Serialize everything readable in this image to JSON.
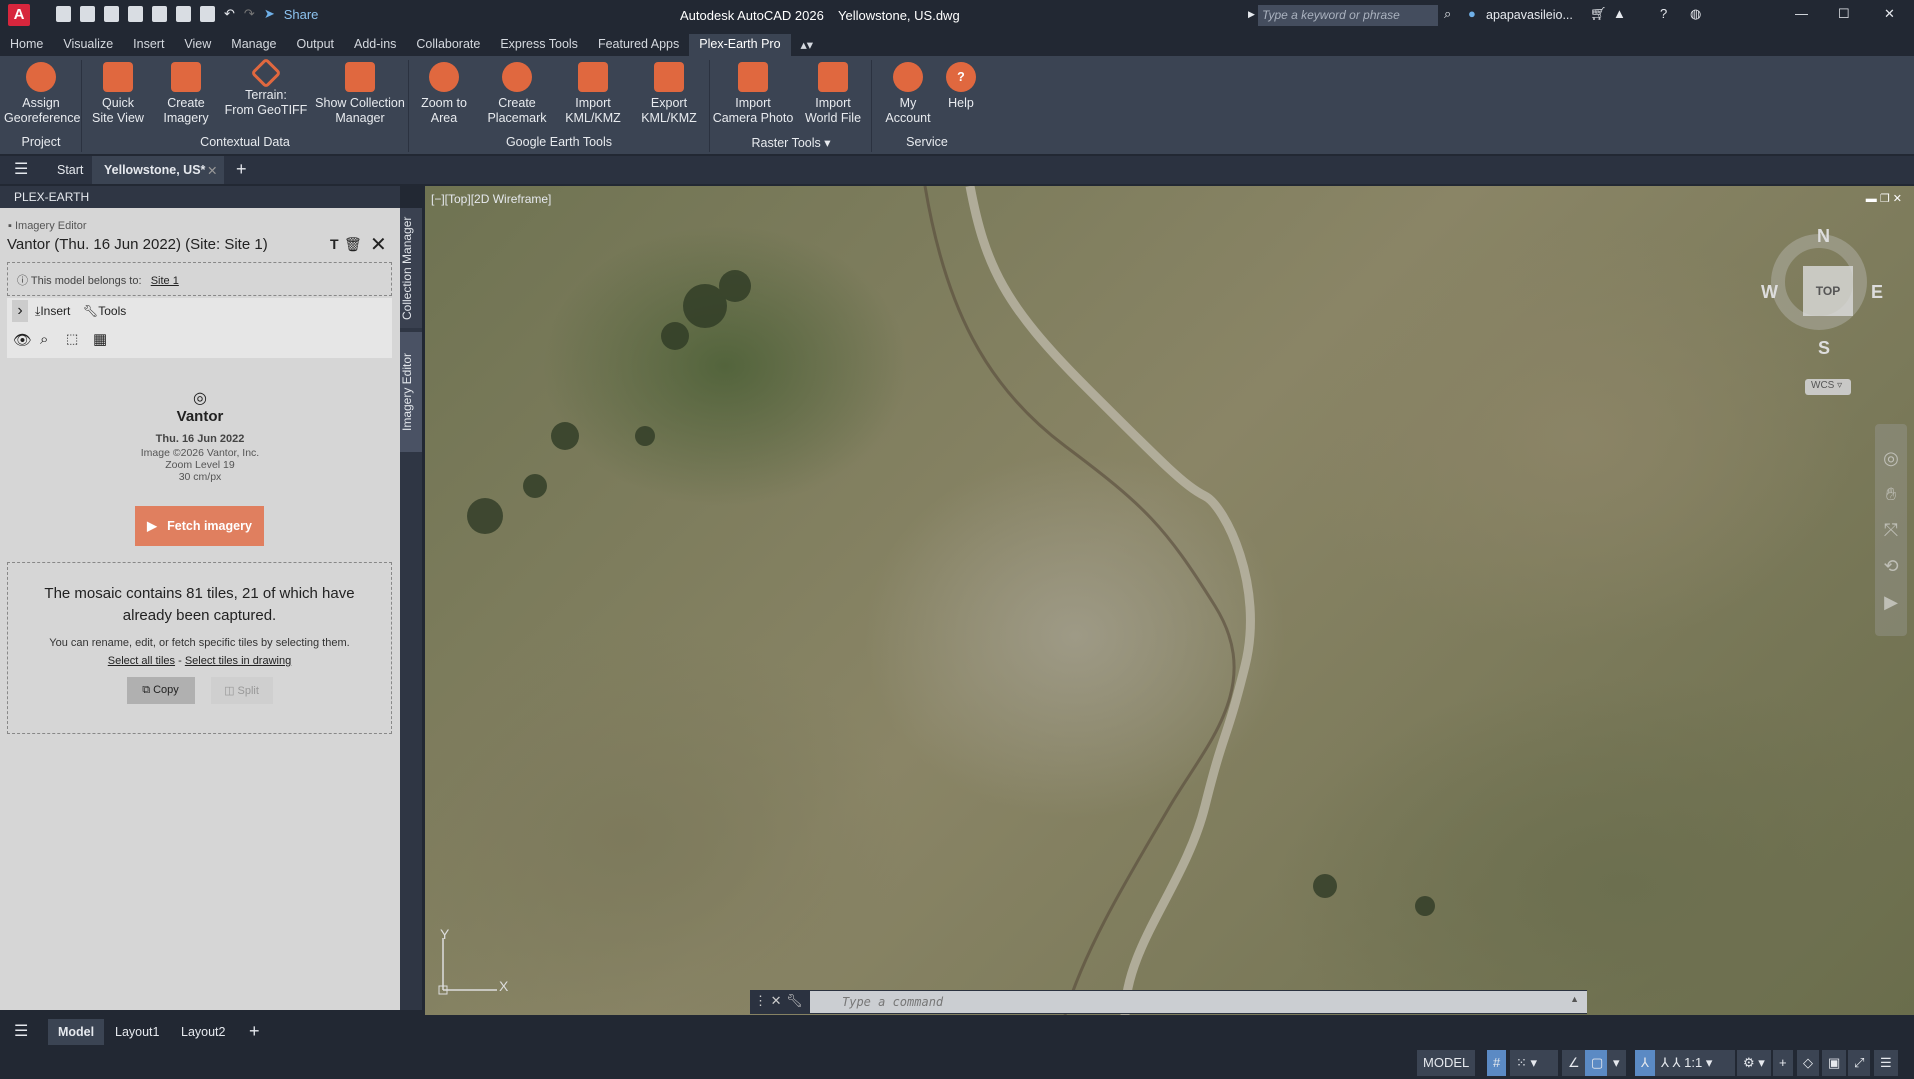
{
  "titlebar": {
    "app_title": "Autodesk AutoCAD 2026    Yellowstone, US.dwg",
    "share": "Share",
    "search_placeholder": "Type a keyword or phrase",
    "user": "apapavasileio...",
    "logo": "A"
  },
  "menu": [
    "Home",
    "Visualize",
    "Insert",
    "View",
    "Manage",
    "Output",
    "Add-ins",
    "Collaborate",
    "Express Tools",
    "Featured Apps",
    "Plex-Earth Pro"
  ],
  "ribbon": {
    "buttons": [
      {
        "l1": "Assign",
        "l2": "Georeference",
        "icon": "georeference-icon"
      },
      {
        "l1": "Quick",
        "l2": "Site View",
        "icon": "quick-site-view-icon"
      },
      {
        "l1": "Create",
        "l2": "Imagery",
        "icon": "create-imagery-icon"
      },
      {
        "l1": "Terrain:",
        "l2": "From GeoTIFF",
        "icon": "terrain-icon"
      },
      {
        "l1": "Show Collection",
        "l2": "Manager",
        "icon": "collection-manager-icon"
      },
      {
        "l1": "Zoom to",
        "l2": "Area",
        "icon": "zoom-to-area-icon"
      },
      {
        "l1": "Create",
        "l2": "Placemark",
        "icon": "placemark-icon"
      },
      {
        "l1": "Import",
        "l2": "KML/KMZ",
        "icon": "import-kml-icon"
      },
      {
        "l1": "Export",
        "l2": "KML/KMZ",
        "icon": "export-kml-icon"
      },
      {
        "l1": "Import",
        "l2": "Camera Photo",
        "icon": "camera-photo-icon"
      },
      {
        "l1": "Import",
        "l2": "World File",
        "icon": "world-file-icon"
      },
      {
        "l1": "My",
        "l2": "Account",
        "icon": "account-icon"
      },
      {
        "l1": "Help",
        "l2": "",
        "icon": "help-icon"
      }
    ],
    "groups": [
      "Project",
      "Contextual Data",
      "Google Earth Tools",
      "Raster Tools ▾",
      "Service"
    ]
  },
  "filetabs": {
    "start": "Start",
    "active": "Yellowstone, US*"
  },
  "panel": {
    "title": "PLEX-EARTH",
    "section": "Imagery Editor",
    "heading": "Vantor (Thu. 16 Jun 2022) (Site: Site 1)",
    "belongs_label": "This model belongs to:",
    "belongs_site": "Site 1",
    "insert": "Insert",
    "tools": "Tools",
    "provider": "Vantor",
    "date": "Thu. 16 Jun 2022",
    "copyright": "Image ©2026 Vantor, Inc.",
    "zoom": "Zoom Level 19",
    "resolution": "30 cm/px",
    "fetch": "Fetch imagery",
    "mosaic": "The mosaic contains 81 tiles, 21 of which have already been captured.",
    "hint": "You can rename, edit, or fetch specific tiles by selecting them.",
    "select_all": "Select all tiles",
    "dash": "-",
    "select_drawing": "Select tiles in drawing",
    "copy": "Copy",
    "split": "Split"
  },
  "sidetabs": [
    "Collection Manager",
    "Imagery Editor"
  ],
  "viewport": {
    "label": "[−][Top][2D Wireframe]",
    "compass": {
      "n": "N",
      "s": "S",
      "e": "E",
      "w": "W",
      "top": "TOP",
      "wcs": "WCS"
    },
    "ucs_x": "X",
    "ucs_y": "Y"
  },
  "command": {
    "placeholder": "Type a command"
  },
  "layouts": [
    "Model",
    "Layout1",
    "Layout2"
  ],
  "status": {
    "model": "MODEL",
    "scale": "1:1"
  },
  "colors": {
    "accent": "#e0683f",
    "ribbon": "#3b4453",
    "active_toggle": "#5b8ac4"
  }
}
